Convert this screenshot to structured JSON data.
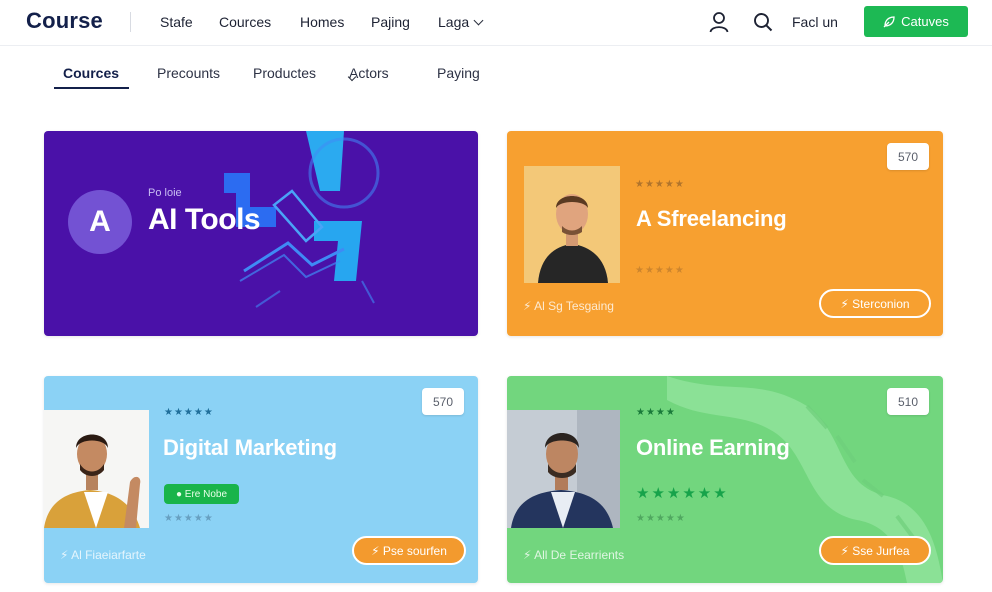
{
  "header": {
    "brand": "Course",
    "nav": [
      "Stafe",
      "Cources",
      "Homes",
      "Pajing",
      "Laga"
    ],
    "find_label": "Facl un",
    "cta_label": "Catuves",
    "icons": [
      "user-icon",
      "search-icon",
      "leaf-icon"
    ],
    "accent_color": "#1db954"
  },
  "subnav": {
    "items": [
      "Cources",
      "Precounts",
      "Productes",
      "Actors",
      "Paying"
    ],
    "active": "Cources"
  },
  "cards": [
    {
      "kicker": "Po loie",
      "logo_letter": "A",
      "title": "AI Tools",
      "color": "#4a11a8"
    },
    {
      "title": "A Sfreelancing",
      "stars": "★★★★★",
      "stars2": "★★★★★",
      "price": "570",
      "footer_text": "⚡ Al Sg Tesgaing",
      "button_label": "⚡ Sterconion",
      "color": "#f7a030"
    },
    {
      "title": "Digital Marketing",
      "stars": "★★★★★",
      "stars2": "★★★★★",
      "badge": "● Ere Nobe",
      "price": "570",
      "footer_text": "⚡ Al Fiaeiarfarte",
      "button_label": "⚡ Pse sourfen",
      "color": "#8bd2f5"
    },
    {
      "title": "Online Earning",
      "stars": "★★★★",
      "stars_big": "★★★★★★",
      "stars2": "★★★★★",
      "price": "510",
      "footer_text": "⚡ All De Eearrients",
      "button_label": "⚡ Sse Jurfea",
      "color": "#72d67e"
    }
  ]
}
